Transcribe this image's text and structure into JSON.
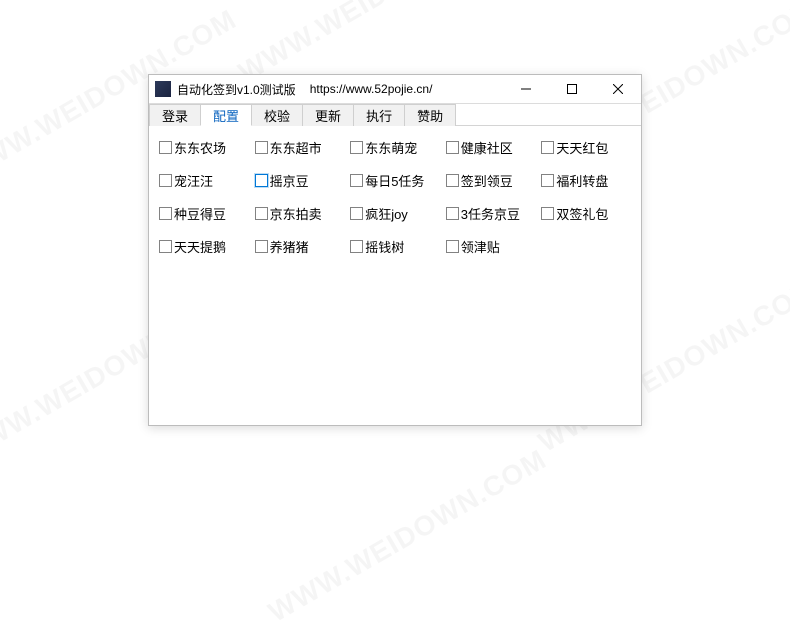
{
  "watermark_text": "WWW.WEIDOWN.COM",
  "titlebar": {
    "title": "自动化签到v1.0测试版",
    "url": "https://www.52pojie.cn/"
  },
  "win_controls": {
    "minimize": "minimize",
    "maximize": "maximize",
    "close": "close"
  },
  "tabs": [
    {
      "label": "登录",
      "active": false
    },
    {
      "label": "配置",
      "active": true
    },
    {
      "label": "校验",
      "active": false
    },
    {
      "label": "更新",
      "active": false
    },
    {
      "label": "执行",
      "active": false
    },
    {
      "label": "赞助",
      "active": false
    }
  ],
  "checkboxes": [
    [
      {
        "label": "东东农场",
        "highlight": false
      },
      {
        "label": "东东超市",
        "highlight": false
      },
      {
        "label": "东东萌宠",
        "highlight": false
      },
      {
        "label": "健康社区",
        "highlight": false
      },
      {
        "label": "天天红包",
        "highlight": false
      }
    ],
    [
      {
        "label": "宠汪汪",
        "highlight": false
      },
      {
        "label": "摇京豆",
        "highlight": true
      },
      {
        "label": "每日5任务",
        "highlight": false
      },
      {
        "label": "签到领豆",
        "highlight": false
      },
      {
        "label": "福利转盘",
        "highlight": false
      }
    ],
    [
      {
        "label": "种豆得豆",
        "highlight": false
      },
      {
        "label": "京东拍卖",
        "highlight": false
      },
      {
        "label": "疯狂joy",
        "highlight": false
      },
      {
        "label": "3任务京豆",
        "highlight": false
      },
      {
        "label": "双签礼包",
        "highlight": false
      }
    ],
    [
      {
        "label": "天天提鹅",
        "highlight": false
      },
      {
        "label": "养猪猪",
        "highlight": false
      },
      {
        "label": "摇钱树",
        "highlight": false
      },
      {
        "label": "领津贴",
        "highlight": false
      }
    ]
  ]
}
